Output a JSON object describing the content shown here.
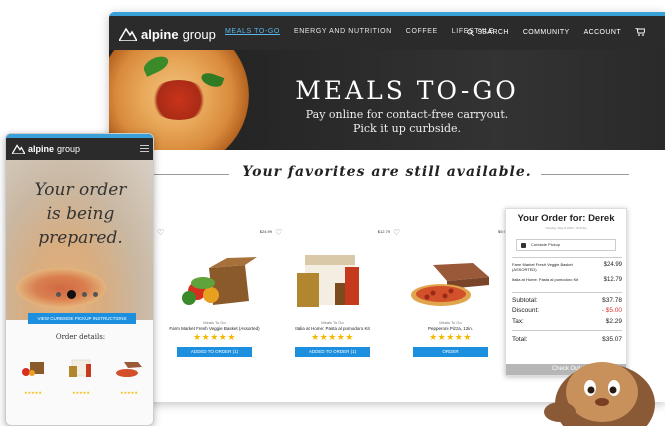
{
  "desktop": {
    "brand": {
      "bold": "alpine",
      "thin": "group"
    },
    "nav": [
      "MEALS TO-GO",
      "ENERGY AND NUTRITION",
      "COFFEE",
      "LIFESTYLE"
    ],
    "nav_right": [
      "SEARCH",
      "COMMUNITY",
      "ACCOUNT"
    ],
    "hero": {
      "title": "MEALS TO-GO",
      "line1": "Pay online for contact-free carryout.",
      "line2": "Pick it up curbside."
    },
    "favorites_heading": "Your favorites are still available.",
    "products": [
      {
        "price": "$24.99",
        "tag": "Meals To Go",
        "name": "Farm Market Fresh Veggie Basket (Assorted)",
        "stars": "★★★★★",
        "button": "ADDED TO ORDER (1)"
      },
      {
        "price": "$12.79",
        "tag": "Meals To Go",
        "name": "Italia at Home: Pasta al pomodoro Kit",
        "stars": "★★★★★",
        "button": "ADDED TO ORDER (1)"
      },
      {
        "price": "$9.99",
        "tag": "Meals To Go",
        "name": "Pepperoni Pizza, 12in.",
        "stars": "★★★★★",
        "button": "ORDER"
      }
    ],
    "order": {
      "title": "Your Order for: Derek",
      "date": "Tuesday, May 8 2020, 10:47am",
      "pickup": "Curbside Pickup",
      "items": [
        {
          "name": "Farm Market Fresh Veggie Basket (ASSORTED)",
          "price": "$24.99"
        },
        {
          "name": "Italia at Home: Pasta al pomodoro Kit",
          "price": "$12.79"
        }
      ],
      "subtotal_label": "Subtotal:",
      "subtotal": "$37.78",
      "discount_label": "Discount:",
      "discount": "- $5.00",
      "tax_label": "Tax:",
      "tax": "$2.29",
      "total_label": "Total:",
      "total": "$35.07",
      "checkout": "Check Out"
    }
  },
  "mobile": {
    "brand": {
      "bold": "alpine",
      "thin": "group"
    },
    "hero_lines": [
      "Your order",
      "is being",
      "prepared."
    ],
    "button": "VIEW CURBSIDE PICKUP INSTRUCTIONS",
    "order_details": "Order details:"
  },
  "colors": {
    "accent": "#1d8fdf",
    "nav_bg": "#2b2b2b",
    "nav_active": "#59b7ea",
    "stars": "#f5b800",
    "discount": "#d33333"
  }
}
